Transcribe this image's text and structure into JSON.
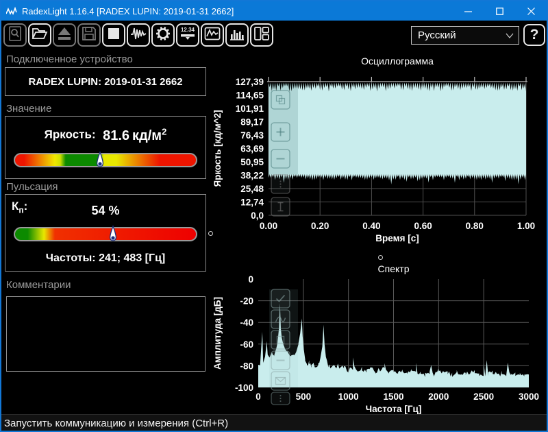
{
  "window": {
    "title": "RadexLight 1.16.4 [RADEX LUPIN: 2019-01-31 2662]"
  },
  "toolbar": {
    "buttons": [
      {
        "name": "inspect",
        "icon": "magnifier-document",
        "enabled": false
      },
      {
        "name": "open",
        "icon": "open-folder",
        "enabled": true
      },
      {
        "name": "eject",
        "icon": "eject",
        "enabled": false
      },
      {
        "name": "save",
        "icon": "save-floppy",
        "enabled": false
      },
      {
        "name": "stop",
        "icon": "stop-square",
        "enabled": true
      },
      {
        "name": "oscillogram-mode",
        "icon": "waveform",
        "enabled": true
      },
      {
        "name": "settings",
        "icon": "gear",
        "enabled": true
      },
      {
        "name": "numeric-display",
        "icon": "digits-display",
        "enabled": true
      },
      {
        "name": "chart-view",
        "icon": "line-chart",
        "enabled": true
      },
      {
        "name": "spectrum-view",
        "icon": "bar-chart",
        "enabled": true
      },
      {
        "name": "layout",
        "icon": "layout-panels",
        "enabled": true
      }
    ],
    "digits_icon_text": "12.34",
    "language_value": "Русский",
    "help_label": "?"
  },
  "left_panel": {
    "device_label": "Подключенное устройство",
    "device_name": "RADEX LUPIN: 2019-01-31 2662",
    "value_label": "Значение",
    "brightness_label": "Яркость:",
    "brightness_value": "81.6",
    "brightness_unit": "кд/м",
    "brightness_unit_sup": "2",
    "brightness_gauge_pct": 47,
    "pulsation_label": "Пульсация",
    "kp_base": "К",
    "kp_sub": "п",
    "kp_colon": ":",
    "kp_value": "54 %",
    "kp_gauge_pct": 54,
    "frequencies": "Частоты: 241; 483 [Гц]",
    "comments_label": "Комментарии",
    "comments_text": ""
  },
  "status_bar": {
    "text": "Запустить коммуникацию и измерения (Ctrl+R)"
  },
  "colors": {
    "titlebar": "#0b79d7",
    "window_border": "#1277d6",
    "chart_fill": "#c9eded",
    "grid": "#4f4f4f",
    "axis": "#bdbdbd",
    "marker_navy": "#1b2f7e"
  },
  "chart_data": [
    {
      "type": "area",
      "title": "Осциллограмма",
      "xlabel": "Время [с]",
      "ylabel": "Яркость [кд/м^2]",
      "x_ticks": [
        "0.00",
        "0.20",
        "0.40",
        "0.60",
        "0.80",
        "1.00"
      ],
      "y_ticks": [
        "127,39",
        "114,65",
        "101,91",
        "89,17",
        "76,43",
        "63,69",
        "50,95",
        "38,22",
        "25,48",
        "12,74",
        "0,0"
      ],
      "xlim": [
        0,
        1
      ],
      "ylim": [
        0,
        127.39
      ],
      "grid": true,
      "series": [
        {
          "name": "luminance-signal",
          "kind": "dense-pulsating-band",
          "band_top_range": [
            120.5,
            127.39
          ],
          "band_bottom_range": [
            34.5,
            40.5
          ],
          "note": "signal oscillates so densely it fills the band between ~38.22 and 127.39 кд/м^2 for the whole 0–1 s window"
        }
      ]
    },
    {
      "type": "area",
      "title": "Спектр",
      "xlabel": "Частота [Гц]",
      "ylabel": "Амплитуда [дБ]",
      "x_ticks": [
        "0",
        "500",
        "1000",
        "1500",
        "2000",
        "2500",
        "3000"
      ],
      "y_ticks": [
        "0",
        "-20",
        "-40",
        "-60",
        "-80",
        "-100"
      ],
      "xlim": [
        0,
        3000
      ],
      "ylim": [
        -100,
        0
      ],
      "grid": true,
      "main_peaks_hz": [
        241,
        483,
        724
      ],
      "points": [
        [
          0,
          -78
        ],
        [
          20,
          -80
        ],
        [
          45,
          -48
        ],
        [
          55,
          -77
        ],
        [
          75,
          -72
        ],
        [
          95,
          -57
        ],
        [
          105,
          -70
        ],
        [
          125,
          -73
        ],
        [
          150,
          -68
        ],
        [
          175,
          -71
        ],
        [
          195,
          -65
        ],
        [
          215,
          -58
        ],
        [
          230,
          -45
        ],
        [
          241,
          -22
        ],
        [
          250,
          -45
        ],
        [
          262,
          -55
        ],
        [
          285,
          -62
        ],
        [
          310,
          -66
        ],
        [
          335,
          -69
        ],
        [
          365,
          -71
        ],
        [
          395,
          -70
        ],
        [
          420,
          -68
        ],
        [
          445,
          -60
        ],
        [
          465,
          -50
        ],
        [
          483,
          -36
        ],
        [
          492,
          -52
        ],
        [
          505,
          -65
        ],
        [
          520,
          -74
        ],
        [
          540,
          -80
        ],
        [
          565,
          -76
        ],
        [
          590,
          -81
        ],
        [
          615,
          -77
        ],
        [
          640,
          -82
        ],
        [
          665,
          -79
        ],
        [
          690,
          -73
        ],
        [
          710,
          -62
        ],
        [
          724,
          -42
        ],
        [
          735,
          -60
        ],
        [
          750,
          -72
        ],
        [
          775,
          -80
        ],
        [
          800,
          -82
        ],
        [
          850,
          -79
        ],
        [
          900,
          -83
        ],
        [
          950,
          -81
        ],
        [
          1000,
          -84
        ],
        [
          1050,
          -82
        ],
        [
          1100,
          -85
        ],
        [
          1150,
          -82
        ],
        [
          1200,
          -85
        ],
        [
          1250,
          -83
        ],
        [
          1300,
          -86
        ],
        [
          1350,
          -83
        ],
        [
          1400,
          -80
        ],
        [
          1450,
          -85
        ],
        [
          1500,
          -84
        ],
        [
          1550,
          -86
        ],
        [
          1600,
          -84
        ],
        [
          1650,
          -87
        ],
        [
          1700,
          -85
        ],
        [
          1750,
          -87
        ],
        [
          1800,
          -85
        ],
        [
          1850,
          -88
        ],
        [
          1900,
          -86
        ],
        [
          1950,
          -88
        ],
        [
          2000,
          -85
        ],
        [
          2050,
          -87
        ],
        [
          2100,
          -86
        ],
        [
          2150,
          -88
        ],
        [
          2200,
          -86
        ],
        [
          2250,
          -88
        ],
        [
          2300,
          -86
        ],
        [
          2350,
          -87
        ],
        [
          2400,
          -85
        ],
        [
          2450,
          -88
        ],
        [
          2500,
          -87
        ],
        [
          2550,
          -88
        ],
        [
          2600,
          -86
        ],
        [
          2650,
          -88
        ],
        [
          2700,
          -87
        ],
        [
          2750,
          -89
        ],
        [
          2800,
          -87
        ],
        [
          2850,
          -88
        ],
        [
          2900,
          -87
        ],
        [
          2950,
          -88
        ],
        [
          3000,
          -87
        ]
      ]
    }
  ]
}
